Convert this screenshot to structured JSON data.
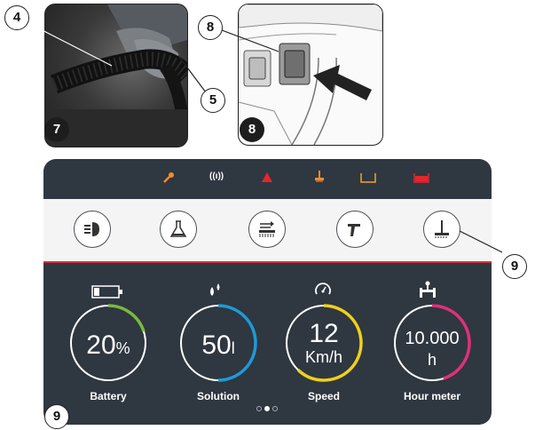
{
  "callouts": {
    "photo_left_hose": "4",
    "photo_left_tube": "5",
    "photo_left_step": "7",
    "photo_right_switch": "8",
    "photo_right_step": "8",
    "panel_button": "9",
    "panel_step": "9"
  },
  "status_icons": [
    {
      "icon": "wrench-icon",
      "color": "#f28c28"
    },
    {
      "icon": "wireless-icon",
      "color": "#ffffff",
      "text": "((ı))"
    },
    {
      "icon": "warning-icon",
      "color": "#e5262d"
    },
    {
      "icon": "brush-icon",
      "color": "#f28c28"
    },
    {
      "icon": "tank-empty-icon",
      "color": "#f2a51e"
    },
    {
      "icon": "tank-full-icon",
      "color": "#e5262d"
    }
  ],
  "mode_buttons": [
    "headlight-icon",
    "detergent-flask-icon",
    "brush-pressure-icon",
    "spray-gun-icon",
    "squeegee-icon"
  ],
  "gauges": [
    {
      "name": "battery",
      "label": "Battery",
      "value": "20",
      "unit": "%",
      "fraction": 0.2,
      "color": "#79b93f"
    },
    {
      "name": "solution",
      "label": "Solution",
      "value": "50",
      "unit": "l",
      "fraction": 0.5,
      "color": "#1f9ad6"
    },
    {
      "name": "speed",
      "label": "Speed",
      "value": "12",
      "unit": "Km/h",
      "fraction": 0.62,
      "color": "#f0d01b"
    },
    {
      "name": "hour-meter",
      "label": "Hour meter",
      "value": "10.000",
      "unit": "h",
      "fraction": 0.45,
      "color": "#e0307a"
    }
  ],
  "pager": {
    "pages": 3,
    "active": 1
  }
}
